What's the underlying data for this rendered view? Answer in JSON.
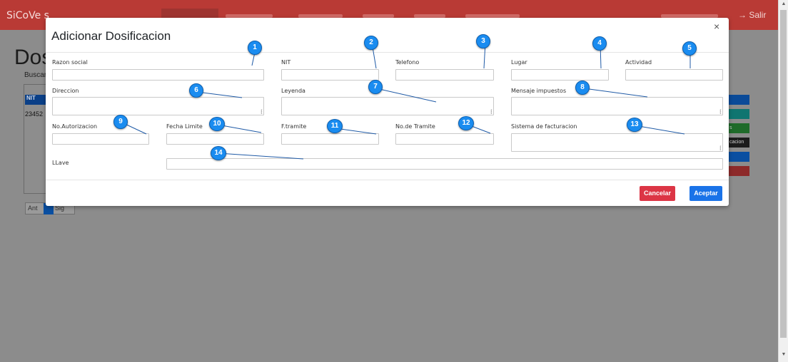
{
  "app": {
    "brand": "SiCoVe s",
    "logout_label": "→ Salir"
  },
  "background": {
    "title": "Dos",
    "search_label": "Buscar",
    "table_header": "NIT",
    "row_value": "23452",
    "pager": {
      "prev": "Ant",
      "next": "Sig"
    },
    "side_buttons": [
      "s",
      "cacion"
    ]
  },
  "modal": {
    "title": "Adicionar Dosificacion",
    "close_glyph": "×",
    "fields": {
      "razon_social": "Razon social",
      "nit": "NIT",
      "telefono": "Telefono",
      "lugar": "Lugar",
      "actividad": "Actividad",
      "direccion": "Direccion",
      "leyenda": "Leyenda",
      "mensaje_impuestos": "Mensaje impuestos",
      "no_autorizacion": "No.Autorizacion",
      "fecha_limite": "Fecha Limite",
      "f_tramite": "F.tramite",
      "no_tramite": "No.de Tramite",
      "sistema_facturacion": "Sistema de facturacion",
      "llave": "LLave"
    },
    "buttons": {
      "cancel": "Cancelar",
      "accept": "Aceptar"
    }
  },
  "callouts": [
    "1",
    "2",
    "3",
    "4",
    "5",
    "6",
    "7",
    "8",
    "9",
    "10",
    "11",
    "12",
    "13",
    "14"
  ],
  "colors": {
    "navbar": "#b93a35",
    "cancel": "#dc3545",
    "accept": "#1a73e8",
    "callout": "#1a8cf0"
  }
}
